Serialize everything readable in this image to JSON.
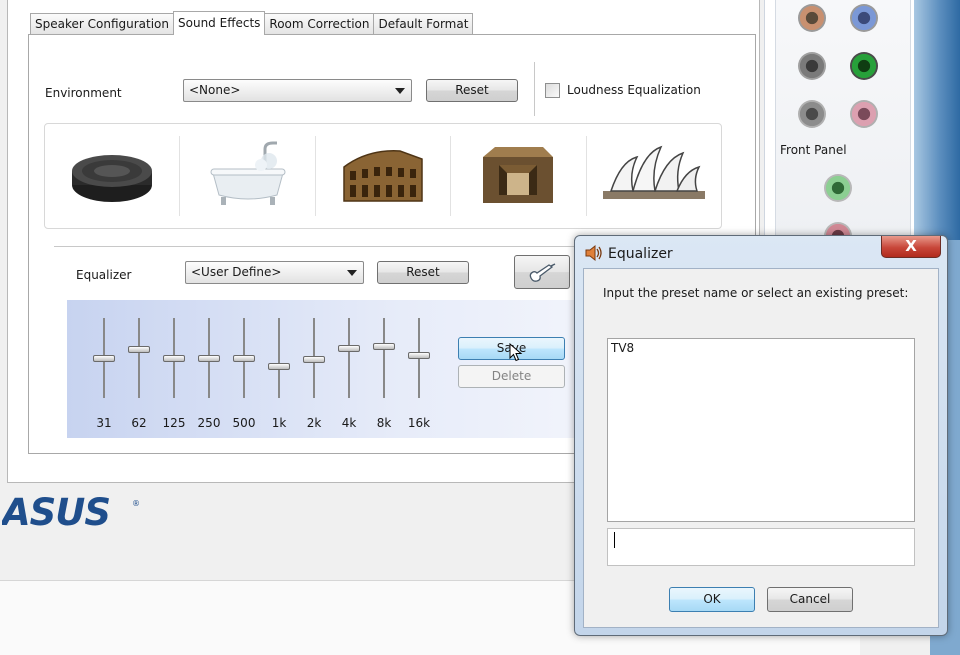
{
  "tabs": [
    {
      "label": "Speaker Configuration"
    },
    {
      "label": "Sound Effects"
    },
    {
      "label": "Room Correction"
    },
    {
      "label": "Default Format"
    }
  ],
  "environment": {
    "label": "Environment",
    "selected": "<None>",
    "reset_label": "Reset",
    "loudness_label": "Loudness Equalization",
    "loudness_checked": false,
    "presets": [
      "stone-disc-icon",
      "bathtub-icon",
      "colosseum-icon",
      "stone-room-icon",
      "opera-house-icon"
    ]
  },
  "equalizer": {
    "label": "Equalizer",
    "selected": "<User Define>",
    "reset_label": "Reset",
    "save_label": "Save",
    "delete_label": "Delete",
    "bands": [
      {
        "freq": "31",
        "level": 0.5
      },
      {
        "freq": "62",
        "level": 0.62
      },
      {
        "freq": "125",
        "level": 0.5
      },
      {
        "freq": "250",
        "level": 0.5
      },
      {
        "freq": "500",
        "level": 0.5
      },
      {
        "freq": "1k",
        "level": 0.38
      },
      {
        "freq": "2k",
        "level": 0.48
      },
      {
        "freq": "4k",
        "level": 0.63
      },
      {
        "freq": "8k",
        "level": 0.66
      },
      {
        "freq": "16k",
        "level": 0.54
      }
    ]
  },
  "right_panel": {
    "front_panel_label": "Front Panel"
  },
  "brand": {
    "logo_text": "ASUS",
    "color": "#1f4e8c"
  },
  "dialog": {
    "title": "Equalizer",
    "prompt": "Input the preset name or select an existing preset:",
    "presets": [
      "TV8"
    ],
    "input_value": "",
    "ok_label": "OK",
    "cancel_label": "Cancel",
    "close_label": "X"
  }
}
